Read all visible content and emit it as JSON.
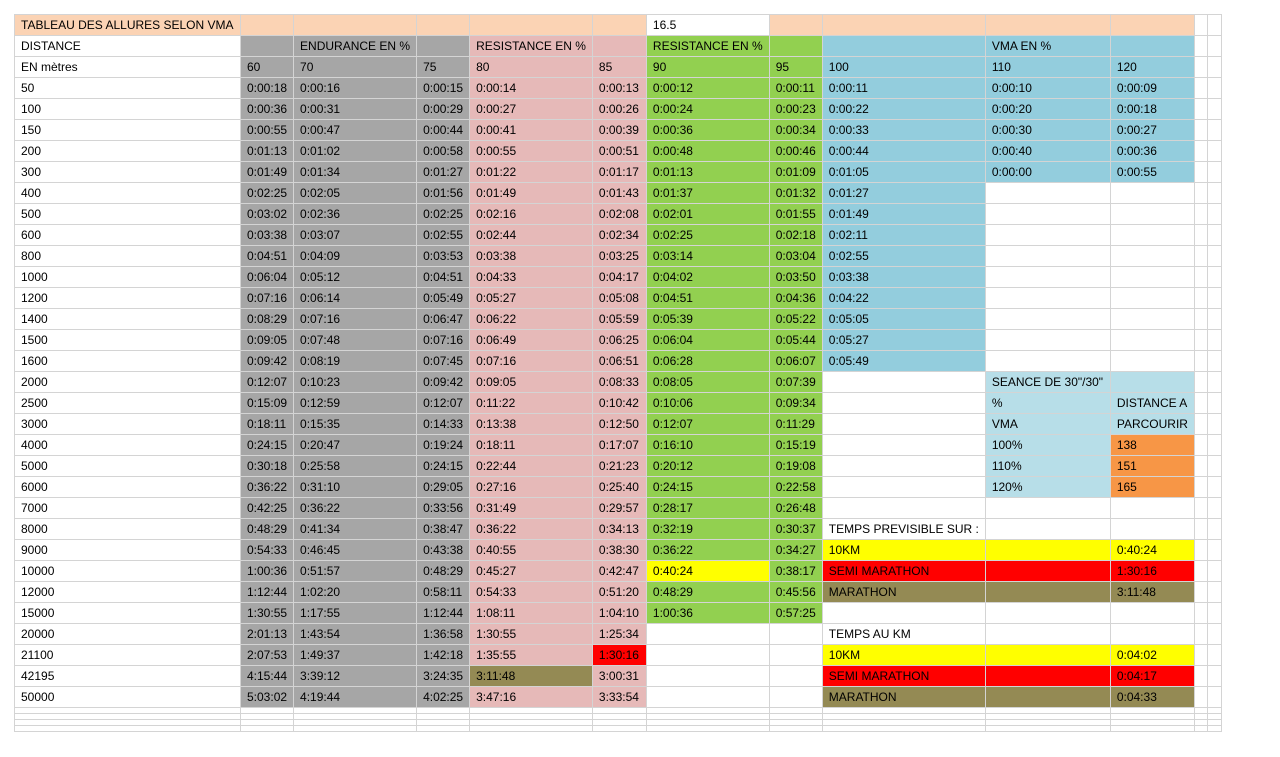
{
  "title": "TABLEAU DES ALLURES SELON VMA",
  "vma_value": "16.5",
  "headers": {
    "distance": "DISTANCE",
    "unit": "EN mètres",
    "endurance": "ENDURANCE EN %",
    "resistance_1": "RESISTANCE EN %",
    "resistance_2": "RESISTANCE EN %",
    "vma": "VMA EN %"
  },
  "percentages": [
    "60",
    "70",
    "75",
    "80",
    "85",
    "90",
    "95",
    "100",
    "110",
    "120"
  ],
  "rows": [
    {
      "distance": "50",
      "times": [
        "0:00:18",
        "0:00:16",
        "0:00:15",
        "0:00:14",
        "0:00:13",
        "0:00:12",
        "0:00:11",
        "0:00:11",
        "0:00:10",
        "0:00:09"
      ]
    },
    {
      "distance": "100",
      "times": [
        "0:00:36",
        "0:00:31",
        "0:00:29",
        "0:00:27",
        "0:00:26",
        "0:00:24",
        "0:00:23",
        "0:00:22",
        "0:00:20",
        "0:00:18"
      ]
    },
    {
      "distance": "150",
      "times": [
        "0:00:55",
        "0:00:47",
        "0:00:44",
        "0:00:41",
        "0:00:39",
        "0:00:36",
        "0:00:34",
        "0:00:33",
        "0:00:30",
        "0:00:27"
      ]
    },
    {
      "distance": "200",
      "times": [
        "0:01:13",
        "0:01:02",
        "0:00:58",
        "0:00:55",
        "0:00:51",
        "0:00:48",
        "0:00:46",
        "0:00:44",
        "0:00:40",
        "0:00:36"
      ]
    },
    {
      "distance": "300",
      "times": [
        "0:01:49",
        "0:01:34",
        "0:01:27",
        "0:01:22",
        "0:01:17",
        "0:01:13",
        "0:01:09",
        "0:01:05",
        "0:00:00",
        "0:00:55"
      ]
    },
    {
      "distance": "400",
      "times": [
        "0:02:25",
        "0:02:05",
        "0:01:56",
        "0:01:49",
        "0:01:43",
        "0:01:37",
        "0:01:32",
        "0:01:27"
      ]
    },
    {
      "distance": "500",
      "times": [
        "0:03:02",
        "0:02:36",
        "0:02:25",
        "0:02:16",
        "0:02:08",
        "0:02:01",
        "0:01:55",
        "0:01:49"
      ]
    },
    {
      "distance": "600",
      "times": [
        "0:03:38",
        "0:03:07",
        "0:02:55",
        "0:02:44",
        "0:02:34",
        "0:02:25",
        "0:02:18",
        "0:02:11"
      ]
    },
    {
      "distance": "800",
      "times": [
        "0:04:51",
        "0:04:09",
        "0:03:53",
        "0:03:38",
        "0:03:25",
        "0:03:14",
        "0:03:04",
        "0:02:55"
      ]
    },
    {
      "distance": "1000",
      "times": [
        "0:06:04",
        "0:05:12",
        "0:04:51",
        "0:04:33",
        "0:04:17",
        "0:04:02",
        "0:03:50",
        "0:03:38"
      ]
    },
    {
      "distance": "1200",
      "times": [
        "0:07:16",
        "0:06:14",
        "0:05:49",
        "0:05:27",
        "0:05:08",
        "0:04:51",
        "0:04:36",
        "0:04:22"
      ]
    },
    {
      "distance": "1400",
      "times": [
        "0:08:29",
        "0:07:16",
        "0:06:47",
        "0:06:22",
        "0:05:59",
        "0:05:39",
        "0:05:22",
        "0:05:05"
      ]
    },
    {
      "distance": "1500",
      "times": [
        "0:09:05",
        "0:07:48",
        "0:07:16",
        "0:06:49",
        "0:06:25",
        "0:06:04",
        "0:05:44",
        "0:05:27"
      ]
    },
    {
      "distance": "1600",
      "times": [
        "0:09:42",
        "0:08:19",
        "0:07:45",
        "0:07:16",
        "0:06:51",
        "0:06:28",
        "0:06:07",
        "0:05:49"
      ]
    },
    {
      "distance": "2000",
      "times": [
        "0:12:07",
        "0:10:23",
        "0:09:42",
        "0:09:05",
        "0:08:33",
        "0:08:05",
        "0:07:39",
        "0:07:16"
      ]
    },
    {
      "distance": "2500",
      "times": [
        "0:15:09",
        "0:12:59",
        "0:12:07",
        "0:11:22",
        "0:10:42",
        "0:10:06",
        "0:09:34",
        "0:09:05"
      ]
    },
    {
      "distance": "3000",
      "times": [
        "0:18:11",
        "0:15:35",
        "0:14:33",
        "0:13:38",
        "0:12:50",
        "0:12:07",
        "0:11:29",
        "0:10:55"
      ]
    },
    {
      "distance": "4000",
      "times": [
        "0:24:15",
        "0:20:47",
        "0:19:24",
        "0:18:11",
        "0:17:07",
        "0:16:10",
        "0:15:19"
      ]
    },
    {
      "distance": "5000",
      "times": [
        "0:30:18",
        "0:25:58",
        "0:24:15",
        "0:22:44",
        "0:21:23",
        "0:20:12",
        "0:19:08"
      ]
    },
    {
      "distance": "6000",
      "times": [
        "0:36:22",
        "0:31:10",
        "0:29:05",
        "0:27:16",
        "0:25:40",
        "0:24:15",
        "0:22:58"
      ]
    },
    {
      "distance": "7000",
      "times": [
        "0:42:25",
        "0:36:22",
        "0:33:56",
        "0:31:49",
        "0:29:57",
        "0:28:17",
        "0:26:48"
      ]
    },
    {
      "distance": "8000",
      "times": [
        "0:48:29",
        "0:41:34",
        "0:38:47",
        "0:36:22",
        "0:34:13",
        "0:32:19",
        "0:30:37"
      ]
    },
    {
      "distance": "9000",
      "times": [
        "0:54:33",
        "0:46:45",
        "0:43:38",
        "0:40:55",
        "0:38:30",
        "0:36:22",
        "0:34:27"
      ]
    },
    {
      "distance": "10000",
      "times": [
        "1:00:36",
        "0:51:57",
        "0:48:29",
        "0:45:27",
        "0:42:47",
        "0:40:24",
        "0:38:17"
      ]
    },
    {
      "distance": "12000",
      "times": [
        "1:12:44",
        "1:02:20",
        "0:58:11",
        "0:54:33",
        "0:51:20",
        "0:48:29",
        "0:45:56"
      ]
    },
    {
      "distance": "15000",
      "times": [
        "1:30:55",
        "1:17:55",
        "1:12:44",
        "1:08:11",
        "1:04:10",
        "1:00:36",
        "0:57:25"
      ]
    },
    {
      "distance": "20000",
      "times": [
        "2:01:13",
        "1:43:54",
        "1:36:58",
        "1:30:55",
        "1:25:34"
      ]
    },
    {
      "distance": "21100",
      "times": [
        "2:07:53",
        "1:49:37",
        "1:42:18",
        "1:35:55",
        "1:30:16"
      ]
    },
    {
      "distance": "42195",
      "times": [
        "4:15:44",
        "3:39:12",
        "3:24:35",
        "3:11:48",
        "3:00:31"
      ]
    },
    {
      "distance": "50000",
      "times": [
        "5:03:02",
        "4:19:44",
        "4:02:25",
        "3:47:16",
        "3:33:54"
      ]
    }
  ],
  "seance": {
    "title": "SEANCE DE 30\"/30\"",
    "col1_header_1": "%",
    "col1_header_2": "VMA",
    "col2_header_1": "DISTANCE A",
    "col2_header_2": "PARCOURIR",
    "rows": [
      {
        "pct": "100%",
        "distance": "138"
      },
      {
        "pct": "110%",
        "distance": "151"
      },
      {
        "pct": "120%",
        "distance": "165"
      }
    ]
  },
  "temps_previsible": {
    "title": "TEMPS PREVISIBLE SUR :",
    "rows": [
      {
        "label": "10KM",
        "value": "0:40:24"
      },
      {
        "label": "SEMI MARATHON",
        "value": "1:30:16"
      },
      {
        "label": "MARATHON",
        "value": "3:11:48"
      }
    ]
  },
  "temps_au_km": {
    "title": "TEMPS AU KM",
    "rows": [
      {
        "label": "10KM",
        "value": "0:04:02"
      },
      {
        "label": "SEMI MARATHON",
        "value": "0:04:17"
      },
      {
        "label": "MARATHON",
        "value": "0:04:33"
      }
    ]
  },
  "colors": {
    "header_peach": "#fbd3b4",
    "endurance_gray": "#a6a6a6",
    "resistance_pink": "#e6b9b8",
    "resistance_green": "#92d050",
    "vma_blue": "#93cddd",
    "seance_light_blue": "#b7dee8",
    "seance_orange": "#f79646",
    "highlight_yellow": "#ffff00",
    "highlight_red": "#ff0000",
    "highlight_olive": "#948a54"
  }
}
